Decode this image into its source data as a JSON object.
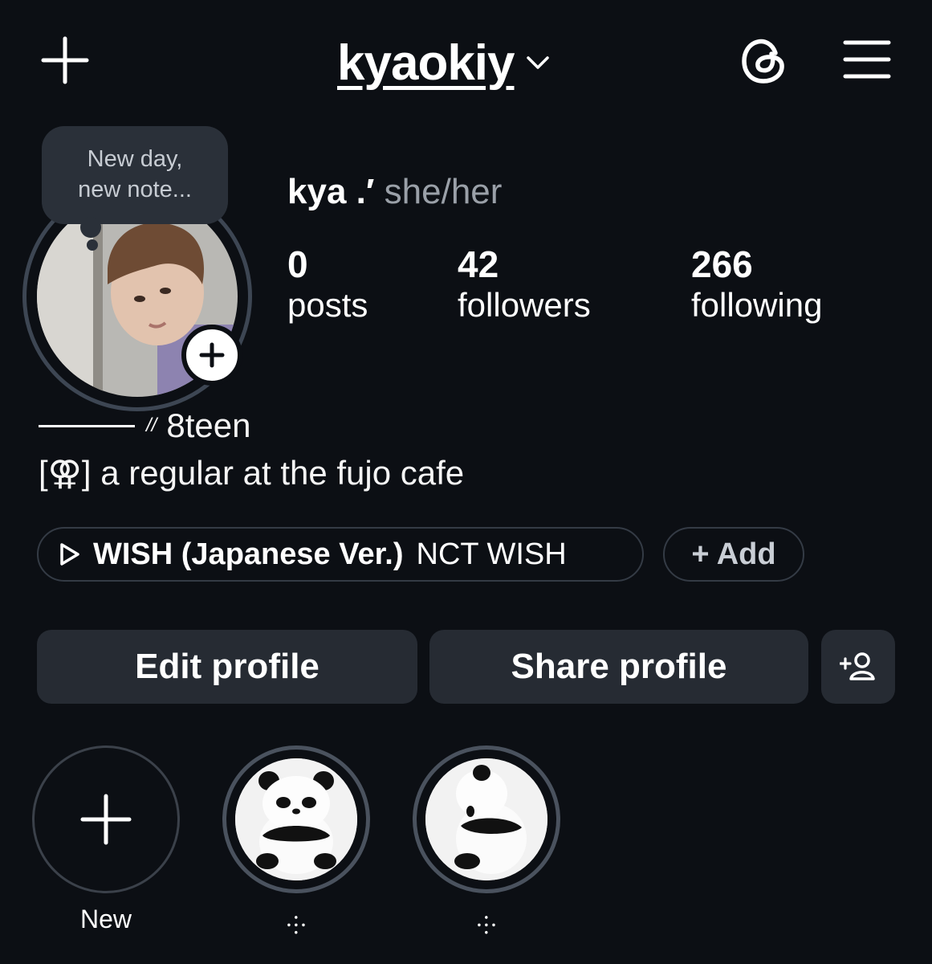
{
  "header": {
    "username": "kyaokiy"
  },
  "note": {
    "text_line1": "New day,",
    "text_line2": "new note..."
  },
  "profile": {
    "name": "kya .′",
    "pronouns": "she/her",
    "stats": [
      {
        "value": "0",
        "label": "posts"
      },
      {
        "value": "42",
        "label": "followers"
      },
      {
        "value": "266",
        "label": "following"
      }
    ],
    "bio_line1_slash": "//",
    "bio_line1_text": "8teen",
    "bio_line2": "[⚢] a regular at the fujo cafe"
  },
  "music": {
    "song": "WISH (Japanese Ver.)",
    "artist": "NCT WISH"
  },
  "add_chip_label": "+ Add",
  "buttons": {
    "edit": "Edit profile",
    "share": "Share profile"
  },
  "highlights": [
    {
      "label": "New"
    },
    {
      "label": "⸭",
      "image": "panda-plush-front"
    },
    {
      "label": "⸭",
      "image": "panda-plush-back"
    }
  ],
  "colors": {
    "background": "#0c0f14",
    "button": "#262b33",
    "muted_text": "#9aa0a8"
  }
}
